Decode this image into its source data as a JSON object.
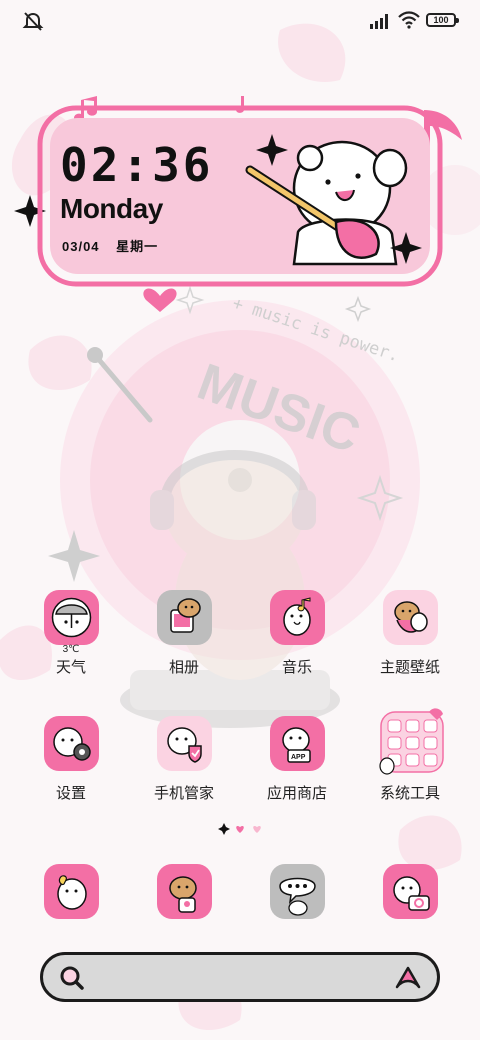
{
  "status_bar": {
    "battery": "100",
    "icons": [
      "mute-icon",
      "signal-icon",
      "wifi-icon",
      "battery-icon"
    ]
  },
  "clock_widget": {
    "time": "02:36",
    "day": "Monday",
    "date": "03/04",
    "weekday": "星期一"
  },
  "background": {
    "caption": "+ music is power.",
    "record_text": "MUSIC"
  },
  "apps": [
    {
      "label": "天气",
      "temp": "3℃",
      "icon": "weather-icon"
    },
    {
      "label": "相册",
      "icon": "gallery-icon"
    },
    {
      "label": "音乐",
      "icon": "music-icon"
    },
    {
      "label": "主题壁纸",
      "icon": "themes-icon"
    },
    {
      "label": "设置",
      "icon": "settings-icon"
    },
    {
      "label": "手机管家",
      "icon": "security-icon"
    },
    {
      "label": "应用商店",
      "icon": "app-store-icon"
    },
    {
      "label": "系统工具",
      "icon": "system-tools-folder-icon"
    }
  ],
  "dock": [
    {
      "icon": "phone-icon"
    },
    {
      "icon": "contacts-icon"
    },
    {
      "icon": "messages-icon"
    },
    {
      "icon": "camera-icon"
    }
  ],
  "page_indicator": {
    "pages": 3,
    "current": 2
  },
  "search_bar": {
    "icons": [
      "search-icon",
      "assistant-icon"
    ]
  },
  "colors": {
    "pink": "#f36fa5",
    "light_pink": "#fbd3e2",
    "widget_fill": "#f8c8da",
    "gray": "#c8c8c8",
    "search_fill": "#d9d9d9",
    "outline": "#1b1b1b"
  }
}
